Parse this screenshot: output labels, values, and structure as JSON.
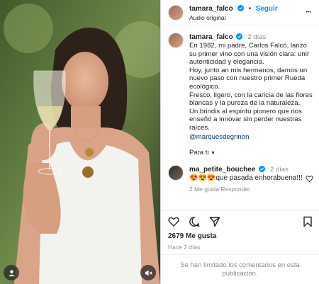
{
  "post": {
    "username": "tamara_falco",
    "follow_label": "Seguir",
    "audio_label": "Audio original",
    "more_label": "•••",
    "separator": "•"
  },
  "caption": {
    "username": "tamara_falco",
    "time": "2 días",
    "text": "En 1982, mi padre, Carlos Falcó, lanzó su primer vino con una visión clara: unir autenticidad y elegancia.\nHoy, junto an mis hermanos, damos un nuevo paso con nuestro primer Rueda ecológico.\nFresco, ligero, con la caricia de las flores blancas y la pureza de la naturaleza.\nUn brindis al espíritu pionero que nos enseñó a innovar sin perder nuestras raíces.",
    "mention": "@marquesdegrinon",
    "translate_label": "Para ti"
  },
  "comment": {
    "username": "ma_petite_bouchee",
    "time": "2 días",
    "text": "😍😍😍que pasada enhorabuena!!!",
    "meta": "2 Me gusta   Responder"
  },
  "stats": {
    "likes": "2679 Me gusta",
    "ago": "Hace 2 días"
  },
  "footer": {
    "limited_text": "Se han limitado los comentarios en esta publicación."
  },
  "colors": {
    "accent": "#0095f6",
    "verified": "#0095f6",
    "muted": "#8e8e8e",
    "text": "#262626",
    "mention": "#00376b"
  },
  "icons": [
    "user-tag-icon",
    "mute-icon",
    "verified-icon",
    "more-icon",
    "heart-icon",
    "comment-icon",
    "share-icon",
    "bookmark-icon"
  ]
}
